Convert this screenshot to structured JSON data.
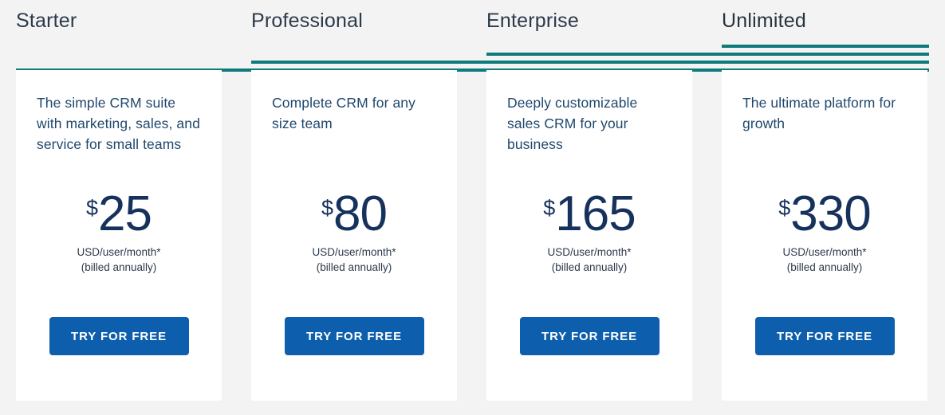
{
  "theme": {
    "page_background": "#f3f3f3",
    "card_background": "#ffffff",
    "accent_teal": "#0d7b7b",
    "cta_blue": "#0d5fad",
    "price_navy": "#16325c",
    "body_navy": "#20486e",
    "tab_text": "#2b3a4a"
  },
  "tabs": [
    {
      "label": "Starter",
      "active": false
    },
    {
      "label": "Professional",
      "active": false
    },
    {
      "label": "Enterprise",
      "active": false
    },
    {
      "label": "Unlimited",
      "active": true
    }
  ],
  "plans": [
    {
      "name": "Starter",
      "description": "The simple CRM suite with marketing, sales, and service for small teams",
      "currency_symbol": "$",
      "price": "25",
      "unit_note": "USD/user/month*",
      "billing_note": "(billed annually)",
      "cta_label": "TRY FOR FREE"
    },
    {
      "name": "Professional",
      "description": "Complete CRM for any size team",
      "currency_symbol": "$",
      "price": "80",
      "unit_note": "USD/user/month*",
      "billing_note": "(billed annually)",
      "cta_label": "TRY FOR FREE"
    },
    {
      "name": "Enterprise",
      "description": "Deeply customizable sales CRM for your business",
      "currency_symbol": "$",
      "price": "165",
      "unit_note": "USD/user/month*",
      "billing_note": "(billed annually)",
      "cta_label": "TRY FOR FREE"
    },
    {
      "name": "Unlimited",
      "description": "The ultimate platform for growth",
      "currency_symbol": "$",
      "price": "330",
      "unit_note": "USD/user/month*",
      "billing_note": "(billed annually)",
      "cta_label": "TRY FOR FREE"
    }
  ]
}
